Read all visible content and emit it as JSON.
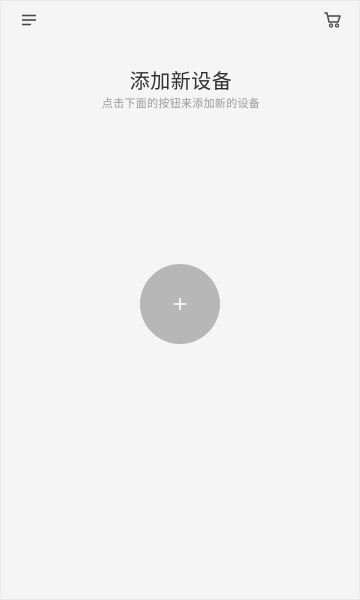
{
  "header": {
    "menu_icon": "menu-icon",
    "cart_icon": "cart-icon"
  },
  "main": {
    "title": "添加新设备",
    "subtitle": "点击下面的按钮来添加新的设备",
    "add_icon": "plus-icon"
  },
  "colors": {
    "background": "#f5f5f5",
    "button": "#b7b7b7",
    "title": "#303030",
    "subtitle": "#9a9a9a"
  }
}
